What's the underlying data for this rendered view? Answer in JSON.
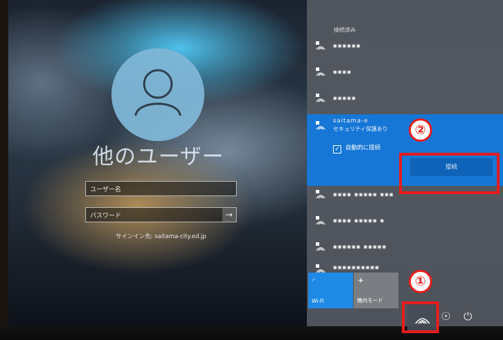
{
  "login": {
    "user_display_name": "他のユーザー",
    "username_placeholder": "ユーザー名",
    "password_placeholder": "パスワード",
    "submit_arrow": "→",
    "signin_to": "サインイン先: saitama-city.ed.jp"
  },
  "network_panel": {
    "connected_label": "接続済み",
    "networks": [
      {
        "name": "▪▪▪▪▪▪"
      },
      {
        "name": "▪▪▪▪"
      },
      {
        "name": "▪▪▪▪▪"
      },
      {
        "name": "saitama-e",
        "status": "セキュリティ保護あり",
        "selected": true
      },
      {
        "name": "▪▪▪▪ ▪▪▪▪▪ ▪▪▪"
      },
      {
        "name": "▪▪▪▪ ▪▪▪▪▪ ▪"
      },
      {
        "name": "▪▪▪▪▪▪ ▪▪▪▪▪"
      },
      {
        "name": "▪▪▪▪▪▪▪▪▪▪"
      }
    ],
    "auto_connect_label": "自動的に接続",
    "connect_button": "接続",
    "tiles": {
      "wifi": "Wi-Fi",
      "airplane": "機内モード"
    }
  },
  "annotations": {
    "step1": "①",
    "step2": "②"
  },
  "colors": {
    "selected_network_bg": "#1677d6",
    "wifi_tile_bg": "#1e8ae6",
    "annotation_red": "#e81c1c"
  }
}
